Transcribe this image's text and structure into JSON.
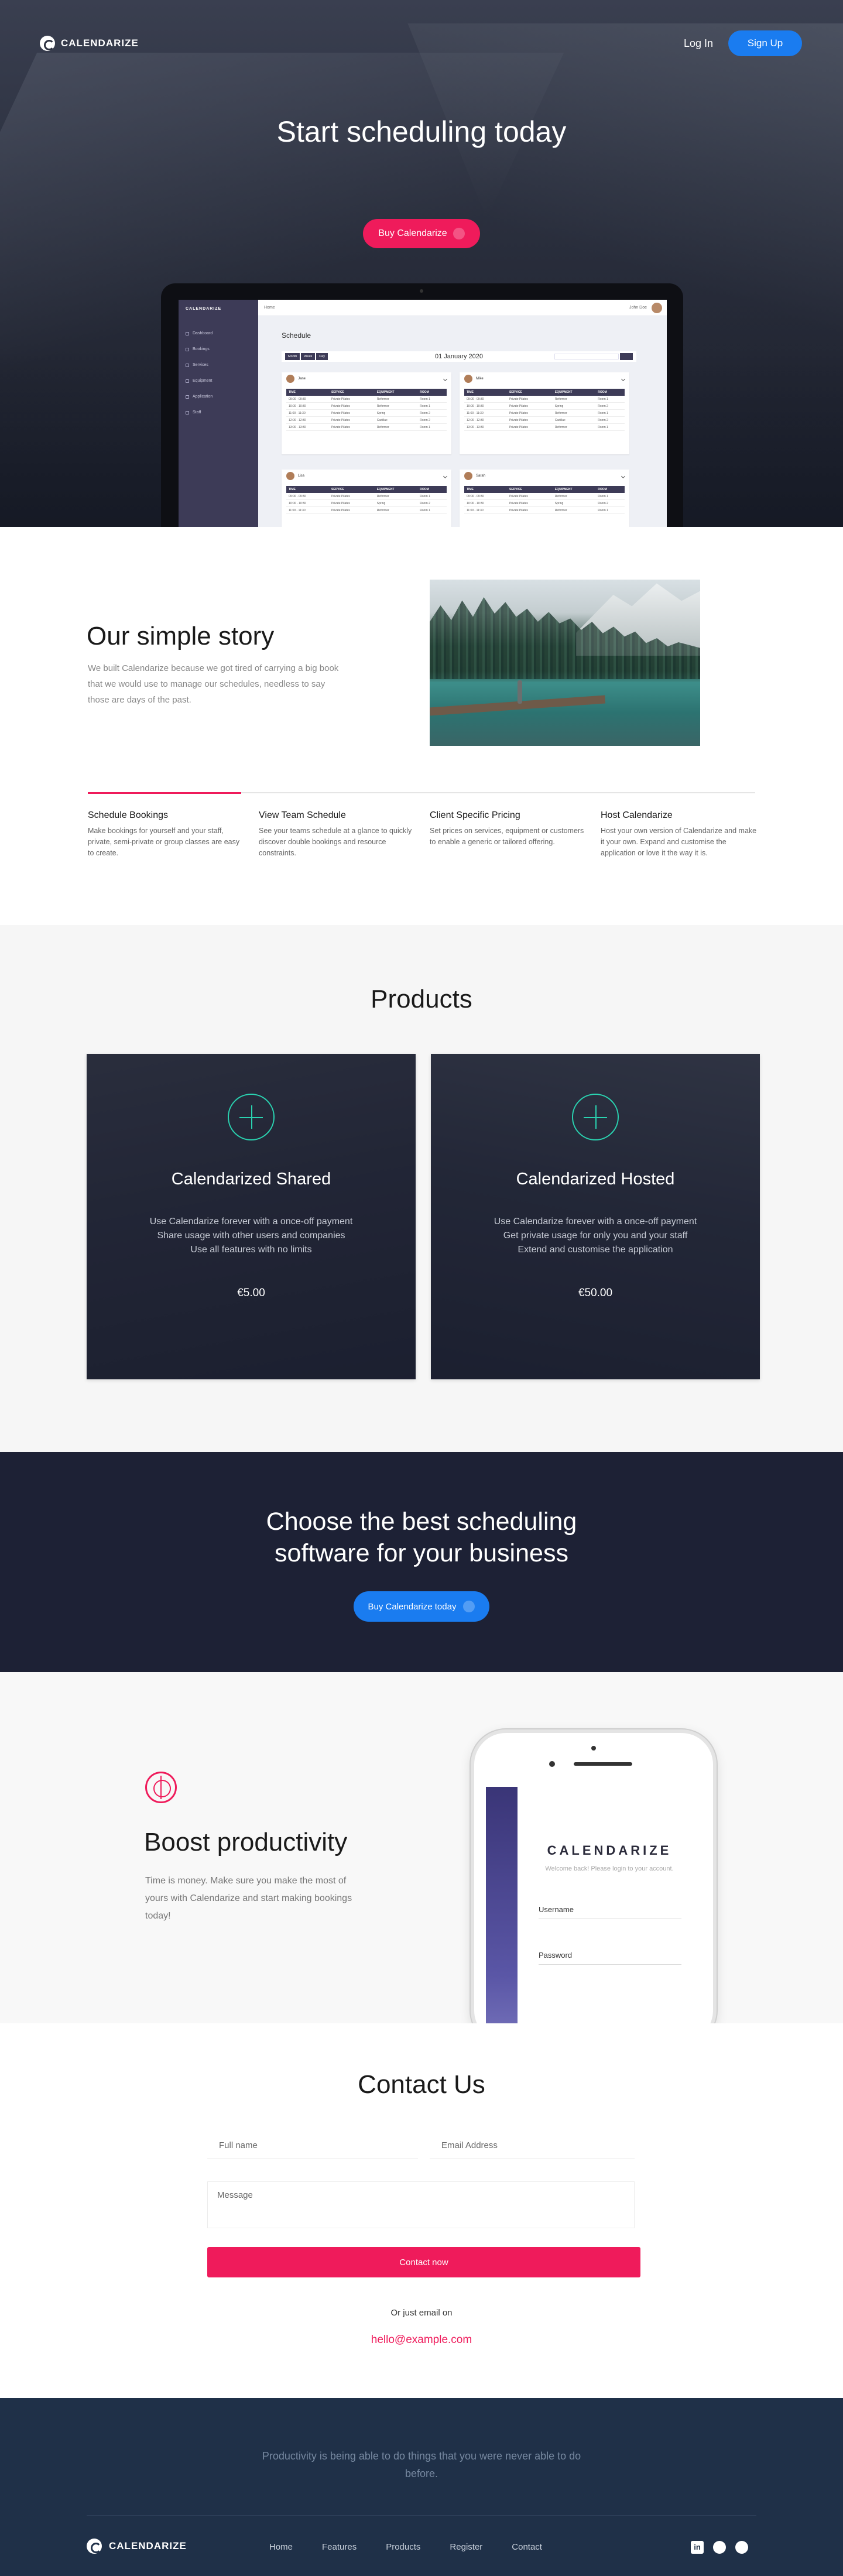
{
  "nav": {
    "brand": "CALENDARIZE",
    "login": "Log In",
    "signup": "Sign Up"
  },
  "hero": {
    "title": "Start scheduling today",
    "button": "Buy Calendarize"
  },
  "app_preview": {
    "brand": "CALENDARIZE",
    "menu": [
      "Dashboard",
      "Bookings",
      "Services",
      "Equipment",
      "Application",
      "Staff"
    ],
    "top_home": "Home",
    "top_user": "John Doe",
    "page_title": "Schedule",
    "view_tabs": [
      "Month",
      "Week",
      "Day"
    ],
    "date": "01 January 2020",
    "columns": [
      "TIME",
      "SERVICE",
      "EQUIPMENT",
      "ROOM"
    ],
    "cards": [
      {
        "name": "Jane",
        "rows": [
          [
            "09:00 - 09:30",
            "Private Pilates",
            "Reformer",
            "Room 1"
          ],
          [
            "10:00 - 10:30",
            "Private Pilates",
            "Reformer",
            "Room 1"
          ],
          [
            "11:00 - 11:30",
            "Private Pilates",
            "Spring",
            "Room 2"
          ],
          [
            "12:00 - 12:30",
            "Private Pilates",
            "Cadillac",
            "Room 2"
          ],
          [
            "13:00 - 13:30",
            "Private Pilates",
            "Reformer",
            "Room 1"
          ]
        ]
      },
      {
        "name": "Mike",
        "rows": [
          [
            "09:00 - 09:30",
            "Private Pilates",
            "Reformer",
            "Room 1"
          ],
          [
            "10:00 - 10:30",
            "Private Pilates",
            "Spring",
            "Room 2"
          ],
          [
            "11:00 - 11:30",
            "Private Pilates",
            "Reformer",
            "Room 1"
          ],
          [
            "12:00 - 12:30",
            "Private Pilates",
            "Cadillac",
            "Room 2"
          ],
          [
            "13:00 - 13:30",
            "Private Pilates",
            "Reformer",
            "Room 1"
          ]
        ]
      },
      {
        "name": "Lisa",
        "rows": [
          [
            "09:00 - 09:30",
            "Private Pilates",
            "Reformer",
            "Room 1"
          ],
          [
            "10:00 - 10:30",
            "Private Pilates",
            "Spring",
            "Room 2"
          ],
          [
            "11:00 - 11:30",
            "Private Pilates",
            "Reformer",
            "Room 1"
          ]
        ]
      },
      {
        "name": "Sarah",
        "rows": [
          [
            "09:00 - 09:30",
            "Private Pilates",
            "Reformer",
            "Room 1"
          ],
          [
            "10:00 - 10:30",
            "Private Pilates",
            "Spring",
            "Room 2"
          ],
          [
            "11:00 - 11:30",
            "Private Pilates",
            "Reformer",
            "Room 1"
          ]
        ]
      }
    ]
  },
  "story": {
    "title": "Our simple story",
    "text": "We built Calendarize because we got tired of carrying a big book that we would use to manage our schedules, needless to say those are days of the past."
  },
  "features": [
    {
      "title": "Schedule Bookings",
      "text": "Make bookings for yourself and your staff, private, semi-private or group classes are easy to create."
    },
    {
      "title": "View Team Schedule",
      "text": "See your teams schedule at a glance to quickly discover double bookings and resource constraints."
    },
    {
      "title": "Client Specific Pricing",
      "text": "Set prices on services, equipment or customers to enable a generic or tailored offering."
    },
    {
      "title": "Host Calendarize",
      "text": "Host your own version of Calendarize and make it your own. Expand and customise the application or love it the way it is."
    }
  ],
  "products": {
    "title": "Products",
    "items": [
      {
        "name": "Calendarized Shared",
        "lines": [
          "Use Calendarize forever with a once-off payment",
          "Share usage with other users and companies",
          "Use all features with no limits"
        ],
        "price": "€5.00"
      },
      {
        "name": "Calendarized Hosted",
        "lines": [
          "Use Calendarize forever with a once-off payment",
          "Get private usage for only you and your staff",
          "Extend and customise the application"
        ],
        "price": "€50.00"
      }
    ]
  },
  "cta": {
    "title_line1": "Choose the best scheduling",
    "title_line2": "software for your business",
    "button": "Buy Calendarize today"
  },
  "boost": {
    "title": "Boost productivity",
    "text": "Time is money. Make sure you make the most of yours with Calendarize and start making bookings today!",
    "phone_brand": "CALENDARIZE",
    "phone_welcome": "Welcome back! Please login to your account.",
    "phone_username": "Username",
    "phone_password": "Password"
  },
  "contact": {
    "title": "Contact Us",
    "fullname_placeholder": "Full name",
    "email_placeholder": "Email Address",
    "message_placeholder": "Message",
    "button": "Contact now",
    "or_email": "Or just email on",
    "email": "hello@example.com"
  },
  "footer": {
    "quote": "Productivity is being able to do things that you were never able to do before.",
    "brand": "CALENDARIZE",
    "links": [
      "Home",
      "Features",
      "Products",
      "Register",
      "Contact"
    ],
    "social": [
      "linkedin-icon",
      "github-icon",
      "dribbble-icon"
    ]
  },
  "colors": {
    "accent_pink": "#ef1b5b",
    "accent_blue": "#1a7cf0",
    "dark_navy": "#1d2135",
    "footer_navy": "#1f3048",
    "product_plus": "#2ad2b0"
  }
}
